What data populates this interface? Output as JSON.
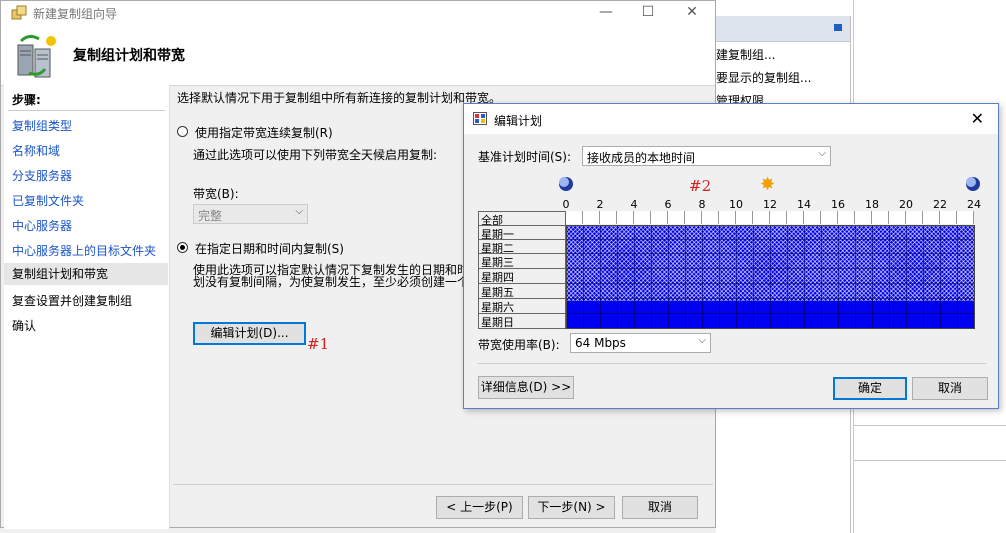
{
  "background_window": {
    "items": [
      "建复制组...",
      "要显示的复制组...",
      "管理权限"
    ]
  },
  "wizard": {
    "title": "新建复制组向导",
    "heading": "复制组计划和带宽",
    "steps_label": "步骤:",
    "steps": [
      {
        "label": "复制组类型",
        "state": "done"
      },
      {
        "label": "名称和域",
        "state": "done"
      },
      {
        "label": "分支服务器",
        "state": "done"
      },
      {
        "label": "已复制文件夹",
        "state": "done"
      },
      {
        "label": "中心服务器",
        "state": "done"
      },
      {
        "label": "中心服务器上的目标文件夹",
        "state": "done"
      },
      {
        "label": "复制组计划和带宽",
        "state": "current"
      },
      {
        "label": "复查设置并创建复制组",
        "state": "pending"
      },
      {
        "label": "确认",
        "state": "pending"
      }
    ],
    "intro": "选择默认情况下用于复制组中所有新连接的复制计划和带宽。",
    "option1": {
      "label": "使用指定带宽连续复制(R)",
      "desc": "通过此选项可以使用下列带宽全天候启用复制:",
      "bandwidth_label": "带宽(B):",
      "bandwidth_value": "完整",
      "selected": false
    },
    "option2": {
      "label": "在指定日期和时间内复制(S)",
      "desc_line1": "使用此选项可以指定默认情况下复制发生的日期和时",
      "desc_line2": "划没有复制间隔，为使复制发生，至少必须创建一个",
      "selected": true
    },
    "edit_schedule_button": "编辑计划(D)...",
    "marker1": "#1",
    "back_button": "< 上一步(P)",
    "next_button": "下一步(N) >",
    "cancel_button": "取消"
  },
  "dialog": {
    "title": "编辑计划",
    "base_time_label": "基准计划时间(S):",
    "base_time_value": "接收成员的本地时间",
    "marker2": "#2",
    "hour_labels": [
      "0",
      "2",
      "4",
      "6",
      "8",
      "10",
      "12",
      "14",
      "16",
      "18",
      "20",
      "22",
      "24"
    ],
    "day_labels": [
      "全部",
      "星期一",
      "星期二",
      "星期三",
      "星期四",
      "星期五",
      "星期六",
      "星期日"
    ],
    "schedule": {
      "weekdays_bandwidth": "64 Mbps",
      "weekend_bandwidth": "Full",
      "all_day": true
    },
    "bandwidth_label": "带宽使用率(B):",
    "bandwidth_value": "64 Mbps",
    "details_button": "详细信息(D) >>",
    "ok_button": "确定",
    "cancel_button": "取消"
  },
  "colors": {
    "schedule_blue": "#0000e6",
    "link_blue": "#1a55c8",
    "marker_red": "#d32020",
    "focus_blue": "#0078d7"
  }
}
